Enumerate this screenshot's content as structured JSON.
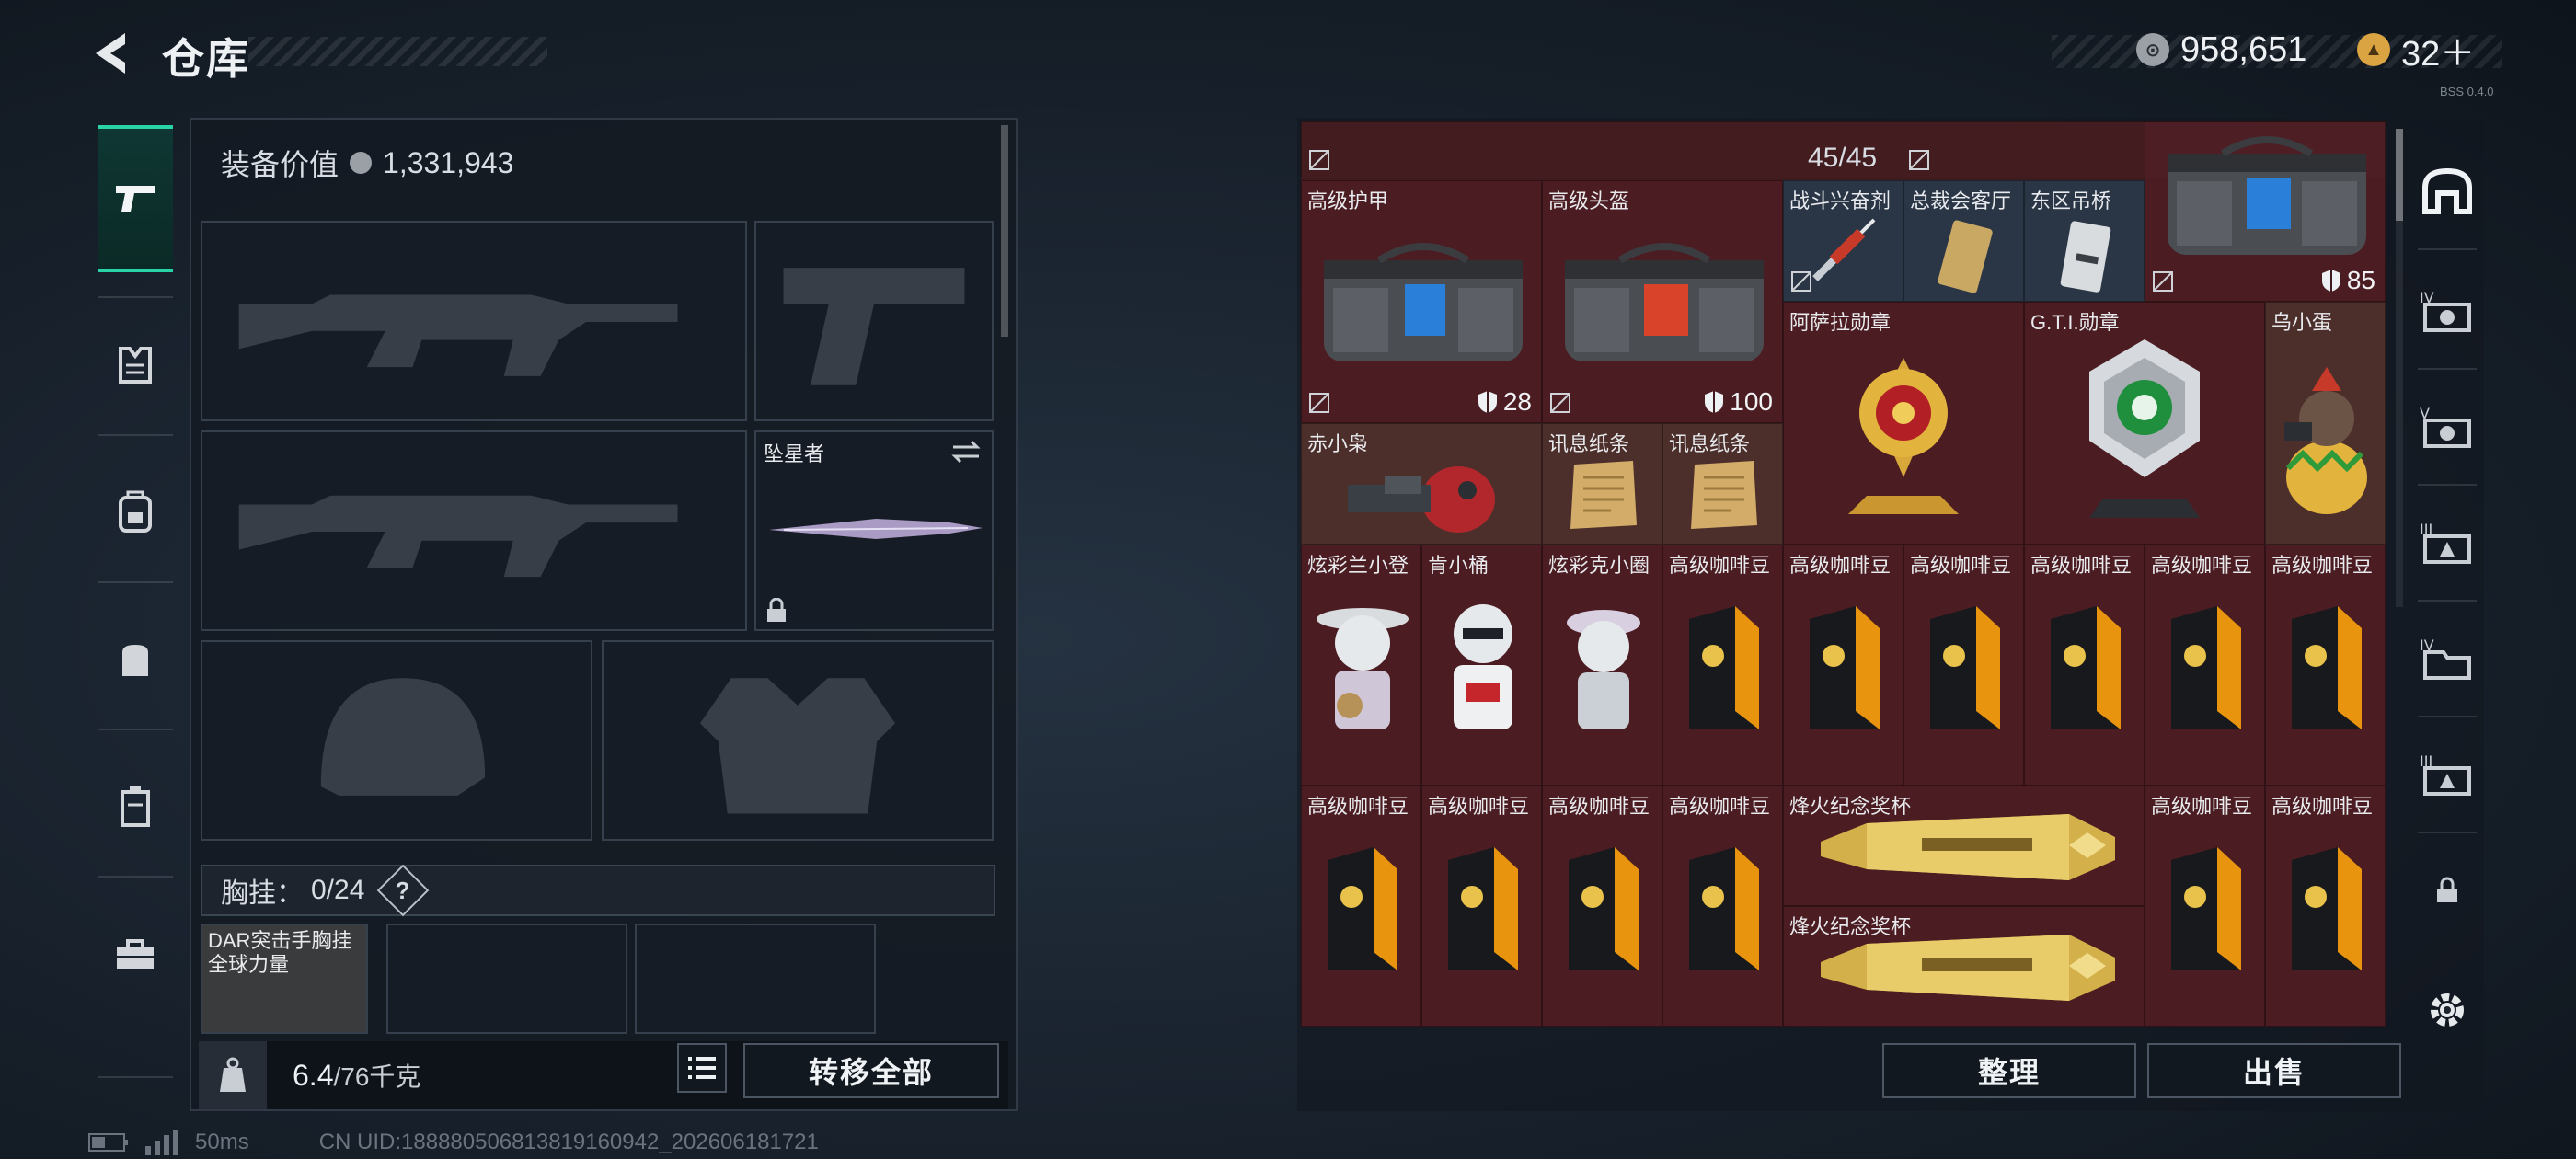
{
  "header": {
    "title": "仓库",
    "currency1": "958,651",
    "currency2": "32＋",
    "version": "BSS 0.4.0"
  },
  "left_nav": [
    "pistol-icon",
    "vest-icon",
    "backpack-icon",
    "pack-icon",
    "case-icon",
    "toolbox-icon"
  ],
  "equipment": {
    "value_label": "装备价值",
    "value": "1,331,943",
    "melee_name": "坠星者",
    "chest_label": "胸挂：",
    "chest_count": "0/24",
    "chest_help": "?",
    "chest_item_line1": "DAR突击手胸挂",
    "chest_item_line2": "全球力量"
  },
  "footer_left": {
    "weight_current": "6.4",
    "weight_total": "/76千克",
    "transfer_all": "转移全部"
  },
  "footer_right": {
    "sort": "整理",
    "sell": "出售"
  },
  "status_bar": {
    "ping": "50ms",
    "uid": "CN UID:18888050681381916094​2_202606181721"
  },
  "inventory": {
    "capacity": "45/45",
    "items": [
      {
        "label": "高级护甲",
        "value": "28"
      },
      {
        "label": "高级头盔",
        "value": "100"
      },
      {
        "label": "战斗兴奋剂"
      },
      {
        "label": "总裁会客厅"
      },
      {
        "label": "东区吊桥"
      },
      {
        "label": "",
        "value": "85"
      },
      {
        "label": "阿萨拉勋章"
      },
      {
        "label": "G.T.I.勋章"
      },
      {
        "label": "乌小蛋"
      },
      {
        "label": "赤小枭"
      },
      {
        "label": "讯息纸条"
      },
      {
        "label": "讯息纸条"
      },
      {
        "label": "炫彩兰小登"
      },
      {
        "label": "肯小桶"
      },
      {
        "label": "炫彩克小圈"
      },
      {
        "label": "高级咖啡豆"
      },
      {
        "label": "高级咖啡豆"
      },
      {
        "label": "高级咖啡豆"
      },
      {
        "label": "高级咖啡豆"
      },
      {
        "label": "高级咖啡豆"
      },
      {
        "label": "高级咖啡豆"
      },
      {
        "label": "高级咖啡豆"
      },
      {
        "label": "高级咖啡豆"
      },
      {
        "label": "高级咖啡豆"
      },
      {
        "label": "高级咖啡豆"
      },
      {
        "label": "烽火纪念奖杯"
      },
      {
        "label": "烽火纪念奖杯"
      },
      {
        "label": "高级咖啡豆"
      },
      {
        "label": "高级咖啡豆"
      }
    ]
  },
  "right_nav": [
    "base-icon",
    "case-iv-icon",
    "case-v-icon",
    "case-iii-icon",
    "folder-iv-icon",
    "case-iii-b-icon",
    "lock-icon",
    "gear-icon"
  ]
}
